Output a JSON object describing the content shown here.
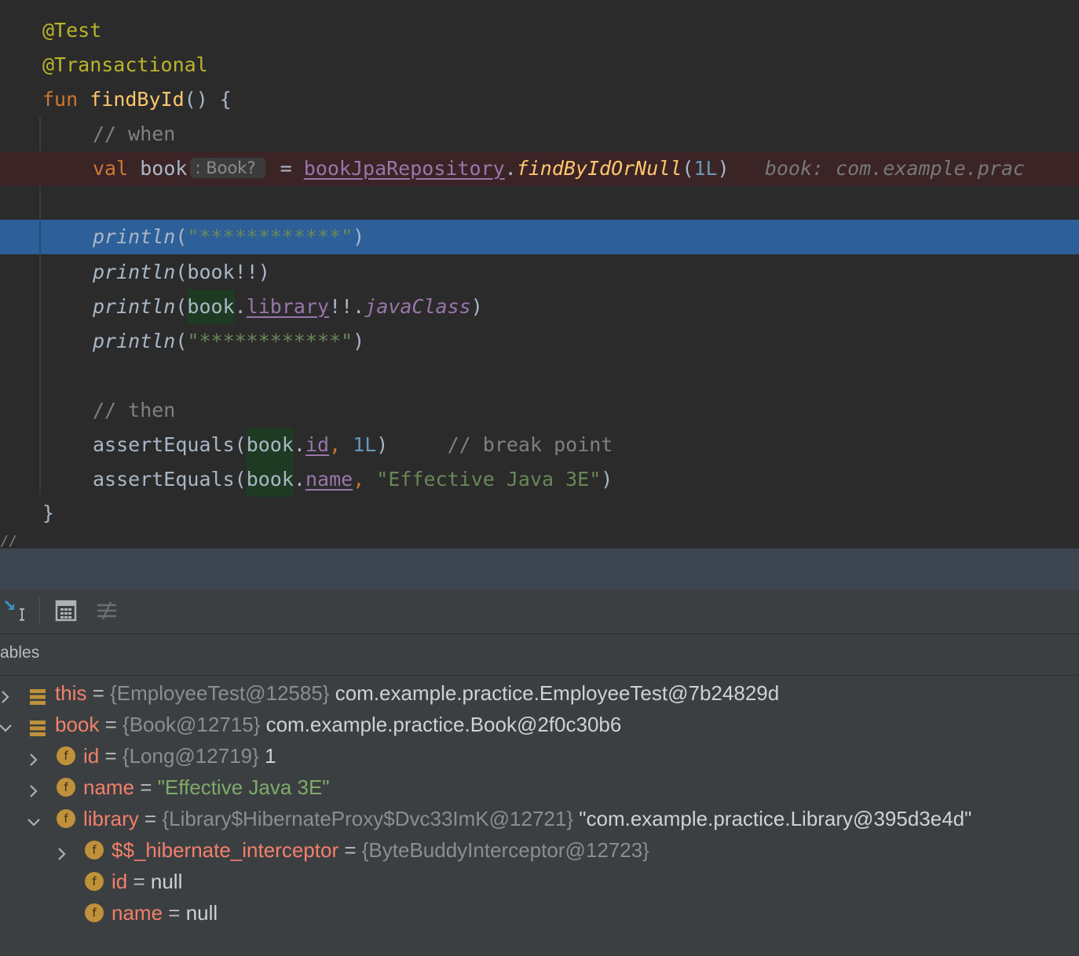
{
  "editor": {
    "annotation_test": "@Test",
    "annotation_transactional": "@Transactional",
    "kw_fun": "fun",
    "fun_name": "findById",
    "fun_sig_rest": "() {",
    "comment_when": "// when",
    "kw_val": "val",
    "var_book": "book",
    "type_hint": ": Book?",
    "assign": " = ",
    "repo_ref": "bookJpaRepository",
    "dot": ".",
    "method_find": "findByIdOrNull",
    "paren_open": "(",
    "arg_1L": "1L",
    "paren_close": ")",
    "inline_value": "book: com.example.prac",
    "println": "println",
    "stars_string": "\"************\"",
    "book_bang": "(book!!)",
    "library_prop": "library",
    "bang_dot": "!!.",
    "java_class": "javaClass",
    "comment_then": "// then",
    "assert_equals": "assertEquals",
    "id_prop": "id",
    "comma": ", ",
    "comment_breakpoint": "// break point",
    "name_prop": "name",
    "effective_java_string": "\"Effective Java 3E\"",
    "closing_brace": "}",
    "cut_comment": "//"
  },
  "debug_panel": {
    "variables_title": "ables",
    "toolbar_icons": [
      "restore-layout-icon",
      "evaluate-expression-icon",
      "compare-icon"
    ]
  },
  "variables": [
    {
      "name": "this",
      "type": "{EmployeeTest@12585}",
      "value": "com.example.practice.EmployeeTest@7b24829d",
      "icon": "object-stack-icon",
      "expanded": false
    },
    {
      "name": "book",
      "type": "{Book@12715}",
      "value": "com.example.practice.Book@2f0c30b6",
      "icon": "object-stack-icon",
      "expanded": true
    },
    {
      "name": "id",
      "type": "{Long@12719}",
      "value": "1",
      "icon": "field-icon",
      "icon_letter": "f",
      "expanded": false
    },
    {
      "name": "name",
      "value": "\"Effective Java 3E\"",
      "icon": "field-icon",
      "icon_letter": "f",
      "expanded": false
    },
    {
      "name": "library",
      "type": "{Library$HibernateProxy$Dvc33ImK@12721}",
      "value": "\"com.example.practice.Library@395d3e4d\"",
      "icon": "field-icon",
      "icon_letter": "f",
      "expanded": true
    },
    {
      "name": "$$_hibernate_interceptor",
      "type": "{ByteBuddyInterceptor@12723}",
      "icon": "field-icon",
      "icon_letter": "f",
      "expanded": false
    },
    {
      "name": "id",
      "value": "null",
      "icon": "field-icon",
      "icon_letter": "f"
    },
    {
      "name": "name",
      "value": "null",
      "icon": "field-icon",
      "icon_letter": "f"
    }
  ],
  "eq": " = ",
  "colors": {
    "editor_bg": "#2b2b2b",
    "exec_line": "#2d5f99",
    "error_line": "#3b2426",
    "panel_bg": "#3c3f41",
    "var_name": "#f2806c",
    "field_icon": "#c0913b"
  }
}
